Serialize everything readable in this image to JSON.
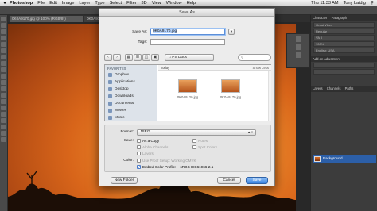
{
  "menubar": {
    "apple": "",
    "app_name": "Photoshop",
    "items": [
      "File",
      "Edit",
      "Image",
      "Layer",
      "Type",
      "Select",
      "Filter",
      "3D",
      "View",
      "Window",
      "Help"
    ],
    "clock": "Thu 11:33 AM",
    "user": "Tony Laidig"
  },
  "photoshop": {
    "doc_tab_active": "0K0A9170.jpg @ 100% (RGB/8*)",
    "doc_tab_inactive": "0K0A9120.jpg @ 10...",
    "panel_tabs": [
      "Character",
      "Paragraph"
    ],
    "font_family": "Great Vibes",
    "panel_rows": [
      "Regular",
      "VA 0",
      "100%"
    ],
    "color_profile_label": "English: USA",
    "adjustments_label": "Add an adjustment",
    "layers_tabs": [
      "Layers",
      "Channels",
      "Paths"
    ],
    "layer_name": "Background"
  },
  "dialog": {
    "window_title": "Save As",
    "save_as_label": "Save As:",
    "save_as_value": "0K0A9170.jpg",
    "tags_label": "Tags:",
    "tags_value": "",
    "location": "PS Docs",
    "search_placeholder": "",
    "sidebar": {
      "header": "FAVORITES",
      "items": [
        "Dropbox",
        "Applications",
        "Desktop",
        "Downloads",
        "Documents",
        "Movies",
        "Music"
      ]
    },
    "files": {
      "section": "Today",
      "show_less": "Show Less",
      "items": [
        "0K0A9120.jpg",
        "0K0A9170.jpg"
      ]
    },
    "format_label": "Format:",
    "format_value": "JPEG",
    "save_label": "Save:",
    "save_options": [
      {
        "label": "As a Copy",
        "checked": false,
        "enabled": true
      },
      {
        "label": "Notes",
        "checked": false,
        "enabled": false
      },
      {
        "label": "Alpha Channels",
        "checked": false,
        "enabled": false
      },
      {
        "label": "Spot Colors",
        "checked": false,
        "enabled": false
      },
      {
        "label": "Layers",
        "checked": false,
        "enabled": false
      }
    ],
    "color_label": "Color:",
    "proof_setup": "Use Proof Setup:  Working CMYK",
    "embed_profile": "Embed Color Profile:",
    "embed_profile_value": "sRGB IEC61966-2.1",
    "new_folder_button": "New Folder",
    "cancel_button": "Cancel",
    "save_button": "Save"
  },
  "colors": {
    "accent_blue": "#3a84e0",
    "selection_blue": "#b6d4fd",
    "sunset_orange": "#ee8a2c"
  }
}
